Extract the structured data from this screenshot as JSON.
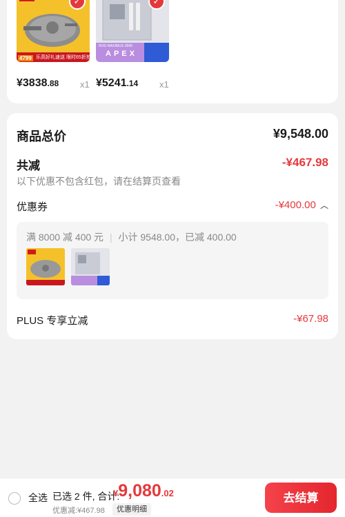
{
  "products": [
    {
      "name": "lego-millennium-falcon",
      "price_main": "¥3838",
      "price_cents": ".88",
      "qty": "x1",
      "banner_tag": "4799",
      "banner_text": "乐高好礼速送 限时65折抢"
    },
    {
      "name": "rog-maximus-apex",
      "price_main": "¥5241",
      "price_cents": ".14",
      "qty": "x1",
      "box_text": "APEX",
      "box_subtext": "ROG MAXIMUS Z890"
    }
  ],
  "summary": {
    "total_label": "商品总价",
    "total_value": "¥9,548.00",
    "discount_label": "共减",
    "discount_value": "-¥467.98",
    "discount_note": "以下优惠不包含红包，请在结算页查看",
    "coupon_label": "优惠券",
    "coupon_value": "-¥400.00",
    "coupon_detail": "满 8000 减 400 元",
    "coupon_subtotal": "小计 9548.00，已减 400.00",
    "plus_label": "PLUS 专享立减",
    "plus_value": "-¥67.98"
  },
  "bottom": {
    "select_all": "全选",
    "selected_count": "已选 2 件, 合计:",
    "total_symbol": "¥",
    "total_main": "9,080",
    "total_cents": ".02",
    "saved_text": "优惠减:¥467.98",
    "detail_button": "优惠明细",
    "checkout_button": "去结算"
  },
  "colors": {
    "accent": "#e4393c",
    "lego_yellow": "#f5c12b"
  }
}
